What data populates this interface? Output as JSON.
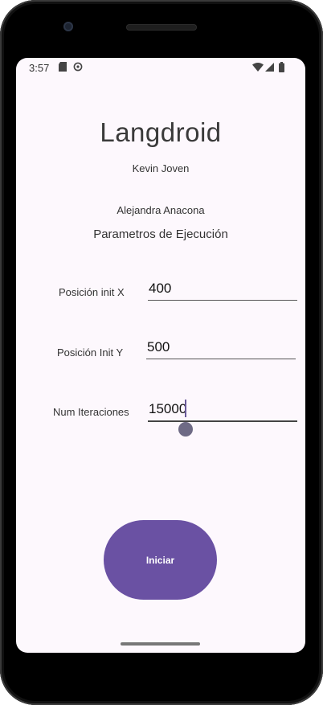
{
  "status_bar": {
    "time": "3:57",
    "icons": [
      "sd-card-icon",
      "sync-icon",
      "wifi-icon",
      "signal-icon",
      "battery-icon"
    ]
  },
  "app": {
    "title": "Langdroid",
    "author_1": "Kevin Joven",
    "author_2": "Alejandra Anacona",
    "section_title": "Parametros de Ejecución"
  },
  "form": {
    "x": {
      "label": "Posición init X",
      "value": "400"
    },
    "y": {
      "label": "Posición Init Y",
      "value": "500"
    },
    "iterations": {
      "label": "Num Iteraciones",
      "value": "15000"
    }
  },
  "start_button": {
    "label": "Iniciar"
  },
  "colors": {
    "accent": "#6a51a3",
    "background": "#fdf8fd"
  }
}
